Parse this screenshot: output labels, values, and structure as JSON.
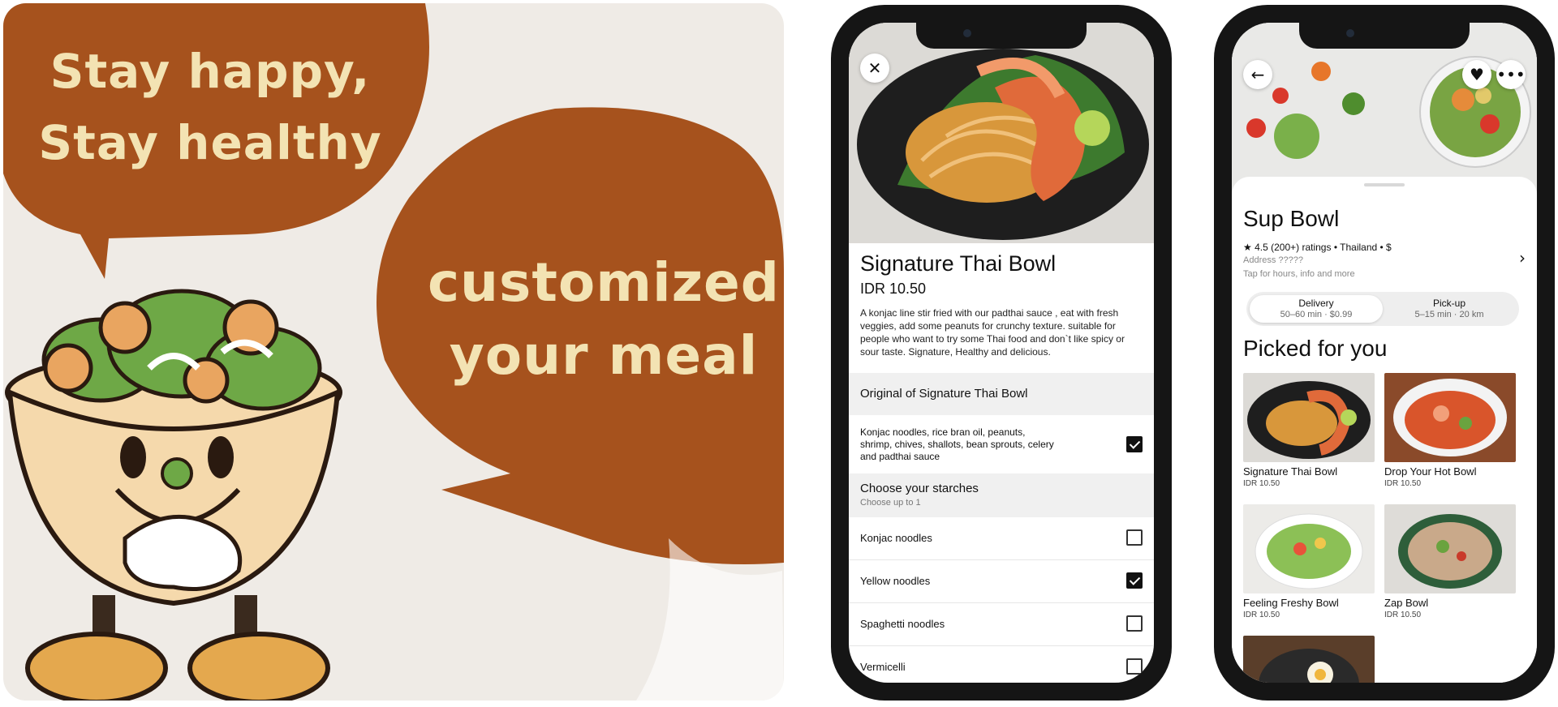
{
  "poster": {
    "line1": "Stay happy,",
    "line2": "Stay healthy",
    "line3": "customized",
    "line4": "your meal",
    "colors": {
      "bubble": "#a6521d",
      "text": "#f3e3b3",
      "background": "#efebe6"
    }
  },
  "detail": {
    "close_icon": "close-icon",
    "title": "Signature Thai Bowl",
    "price": "IDR 10.50",
    "description": "A konjac line stir fried with our padthai sauce , eat with fresh veggies, add some peanuts for crunchy texture. suitable for people who want to try some Thai food and don`t like spicy or sour taste. Signature, Healthy and delicious.",
    "original_section": "Original of Signature Thai Bowl",
    "original_item": "Konjac noodles, rice bran oil, peanuts, shrimp, chives, shallots, bean sprouts, celery and padthai sauce",
    "original_checked": true,
    "starch_section": "Choose your starches",
    "starch_hint": "Choose up to 1",
    "starches": [
      {
        "label": "Konjac noodles",
        "checked": false
      },
      {
        "label": "Yellow noodles",
        "checked": true
      },
      {
        "label": "Spaghetti noodles",
        "checked": false
      },
      {
        "label": "Vermicelli",
        "checked": false
      }
    ]
  },
  "restaurant": {
    "name": "Sup Bowl",
    "rating": "4.5",
    "meta": "4.5 (200+) ratings • Thailand • $",
    "address": "Address ?????",
    "tap_info": "Tap for hours, info and more",
    "delivery": {
      "label": "Delivery",
      "detail": "50–60 min · $0.99",
      "selected": true
    },
    "pickup": {
      "label": "Pick-up",
      "detail": "5–15 min · 20 km",
      "selected": false
    },
    "picked_title": "Picked for you",
    "items": [
      {
        "name": "Signature Thai Bowl",
        "price": "IDR 10.50"
      },
      {
        "name": "Drop Your Hot Bowl",
        "price": "IDR 10.50"
      },
      {
        "name": "Feeling Freshy Bowl",
        "price": "IDR 10.50"
      },
      {
        "name": "Zap Bowl",
        "price": "IDR 10.50"
      }
    ],
    "icons": {
      "back": "back-arrow-icon",
      "favorite": "heart-icon",
      "more": "more-icon"
    }
  }
}
